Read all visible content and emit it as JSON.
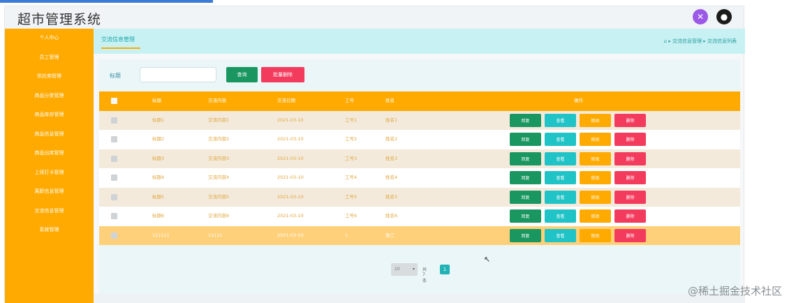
{
  "app": {
    "title": "超市管理系统"
  },
  "header": {
    "icon_purple": "close-icon",
    "icon_user": "user-icon"
  },
  "sidebar": {
    "items": [
      {
        "label": "个人中心"
      },
      {
        "label": "员工管理"
      },
      {
        "label": "供应商管理"
      },
      {
        "label": "商品分类管理"
      },
      {
        "label": "商品库存管理"
      },
      {
        "label": "商品信息管理"
      },
      {
        "label": "商品出库管理"
      },
      {
        "label": "上班打卡管理"
      },
      {
        "label": "离职信息管理"
      },
      {
        "label": "交流信息管理"
      },
      {
        "label": "系统管理"
      }
    ]
  },
  "breadcrumb": {
    "tab": "交流信息管理",
    "path": "⌂ ▸ 交流信息管理 ▸ 交流信息列表"
  },
  "search": {
    "label": "标题",
    "button": "查询",
    "bulk_delete": "批量删除"
  },
  "table": {
    "columns": [
      "标题",
      "交流内容",
      "交流日期",
      "工号",
      "姓名",
      "操作"
    ],
    "rows": [
      {
        "title": "标题1",
        "content": "交流内容1",
        "date": "2021-03-10",
        "empno": "工号1",
        "name": "姓名1"
      },
      {
        "title": "标题2",
        "content": "交流内容2",
        "date": "2021-03-10",
        "empno": "工号2",
        "name": "姓名2"
      },
      {
        "title": "标题3",
        "content": "交流内容3",
        "date": "2021-03-10",
        "empno": "工号3",
        "name": "姓名3"
      },
      {
        "title": "标题4",
        "content": "交流内容4",
        "date": "2021-03-10",
        "empno": "工号4",
        "name": "姓名4"
      },
      {
        "title": "标题5",
        "content": "交流内容5",
        "date": "2021-03-10",
        "empno": "工号5",
        "name": "姓名5"
      },
      {
        "title": "标题6",
        "content": "交流内容6",
        "date": "2021-03-10",
        "empno": "工号6",
        "name": "姓名6"
      },
      {
        "title": "111111",
        "content": "11111",
        "date": "2021-03-03",
        "empno": "1",
        "name": "张三"
      }
    ],
    "ops": {
      "reply": "回复",
      "view": "查看",
      "edit": "修改",
      "delete": "删除"
    }
  },
  "pagination": {
    "page_size": "10",
    "total": "共7条",
    "current": "1"
  },
  "watermark": "@稀土掘金技术社区",
  "colors": {
    "accent": "#ffaa00",
    "teal": "#20c3c6",
    "green": "#1a9660",
    "red": "#f33b5d"
  }
}
